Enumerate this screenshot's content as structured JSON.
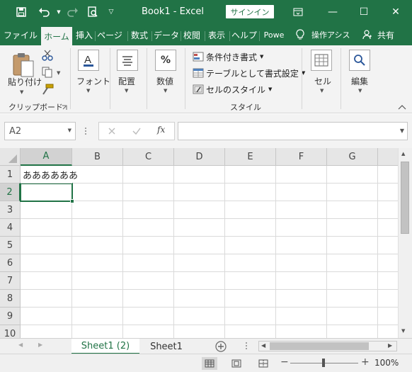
{
  "window": {
    "title": "Book1  -  Excel",
    "signin": "サインイン",
    "qat": {
      "save_icon": "save-icon",
      "undo_icon": "undo-icon",
      "redo_icon": "redo-icon",
      "preview_icon": "print-preview-icon",
      "customize_icon": "chevron-down-icon"
    },
    "controls": {
      "ribbon_opts": "▭",
      "minimize": "—",
      "maximize": "☐",
      "close": "✕"
    }
  },
  "tabs": [
    {
      "label": "ファイル"
    },
    {
      "label": "ホーム"
    },
    {
      "label": "挿入"
    },
    {
      "label": "ページ"
    },
    {
      "label": "数式"
    },
    {
      "label": "データ"
    },
    {
      "label": "校閲"
    },
    {
      "label": "表示"
    },
    {
      "label": "ヘルプ"
    },
    {
      "label": "Powe"
    },
    {
      "label": "操作アシス"
    },
    {
      "label": "共有"
    }
  ],
  "ribbon": {
    "clipboard": {
      "paste": "貼り付け",
      "group": "クリップボード"
    },
    "font": {
      "label": "フォント"
    },
    "alignment": {
      "label": "配置"
    },
    "number": {
      "label": "数値",
      "icon_text": "%"
    },
    "styles": {
      "conditional": "条件付き書式",
      "table": "テーブルとして書式設定",
      "cell_styles": "セルのスタイル",
      "group": "スタイル"
    },
    "cells": {
      "label": "セル"
    },
    "editing": {
      "label": "編集"
    }
  },
  "formula_bar": {
    "name_box": "A2",
    "fx": "fx",
    "content": ""
  },
  "grid": {
    "columns": [
      "A",
      "B",
      "C",
      "D",
      "E",
      "F",
      "G"
    ],
    "rows": [
      "1",
      "2",
      "3",
      "4",
      "5",
      "6",
      "7",
      "8",
      "9",
      "10"
    ],
    "cells": {
      "A1": "ああああああ"
    },
    "active_cell": "A2"
  },
  "sheets": [
    {
      "label": "Sheet1 (2)",
      "active": true
    },
    {
      "label": "Sheet1",
      "active": false
    }
  ],
  "status": {
    "zoom": "100%",
    "minus": "−",
    "plus": "+"
  },
  "colors": {
    "accent": "#217346",
    "ribbon_bg": "#f3f3f3",
    "header_bg": "#e6e6e6"
  }
}
